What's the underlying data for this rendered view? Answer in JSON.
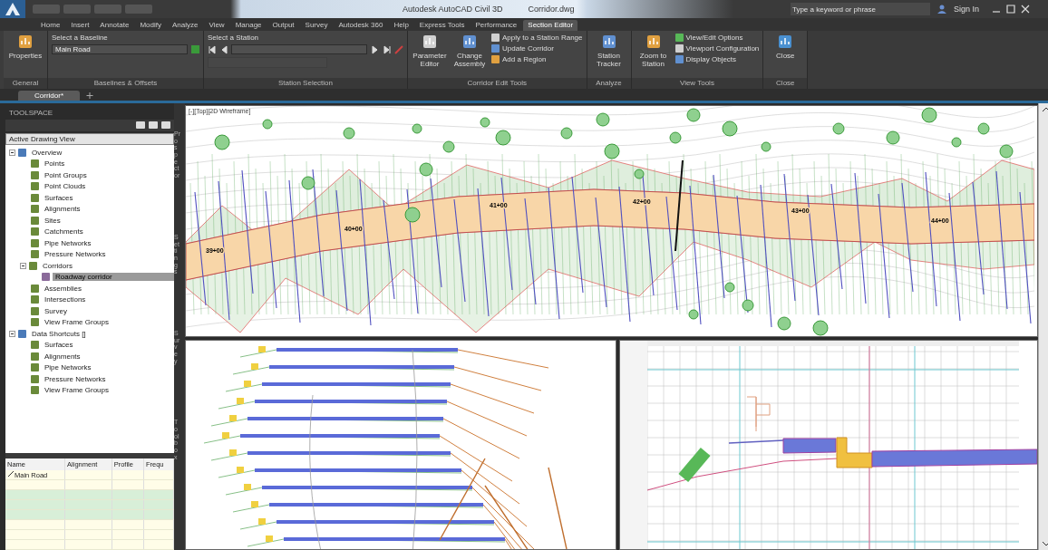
{
  "title_bar": {
    "title": "Autodesk AutoCAD Civil 3D",
    "file": "Corridor.dwg",
    "search_placeholder": "Type a keyword or phrase",
    "user": "Sign In"
  },
  "ribbon_tabs": [
    {
      "label": "Home",
      "selected": false
    },
    {
      "label": "Insert",
      "selected": false
    },
    {
      "label": "Annotate",
      "selected": false
    },
    {
      "label": "Modify",
      "selected": false
    },
    {
      "label": "Analyze",
      "selected": false
    },
    {
      "label": "View",
      "selected": false
    },
    {
      "label": "Manage",
      "selected": false
    },
    {
      "label": "Output",
      "selected": false
    },
    {
      "label": "Survey",
      "selected": false
    },
    {
      "label": "Autodesk 360",
      "selected": false
    },
    {
      "label": "Help",
      "selected": false
    },
    {
      "label": "Express Tools",
      "selected": false
    },
    {
      "label": "Performance",
      "selected": false
    },
    {
      "label": "Section Editor",
      "selected": true
    }
  ],
  "ribbon_panels": [
    {
      "title": "General",
      "items": [
        {
          "kind": "large",
          "label": "Properties"
        }
      ]
    },
    {
      "title": "Baselines & Offsets",
      "items": [
        {
          "kind": "caption",
          "label": "Select a Baseline"
        },
        {
          "kind": "combo",
          "label": "Main Road"
        }
      ]
    },
    {
      "title": "Station Selection",
      "items": [
        {
          "kind": "caption",
          "label": "Select a Station"
        },
        {
          "kind": "navcombo"
        },
        {
          "kind": "disabledfield"
        }
      ]
    },
    {
      "title": "Corridor Edit Tools",
      "items": [
        {
          "kind": "large",
          "label": "Parameter Editor"
        },
        {
          "kind": "large",
          "label": "Change Assembly"
        },
        {
          "kind": "small",
          "label": "Apply to a Station Range"
        },
        {
          "kind": "small",
          "label": "Update Corridor"
        },
        {
          "kind": "small",
          "label": "Add a Region"
        }
      ]
    },
    {
      "title": "Analyze",
      "items": [
        {
          "kind": "large",
          "label": "Station Tracker"
        }
      ]
    },
    {
      "title": "View Tools",
      "items": [
        {
          "kind": "large",
          "label": "Zoom to Station"
        },
        {
          "kind": "small",
          "label": "View/Edit Options"
        },
        {
          "kind": "small",
          "label": "Viewport Configuration"
        },
        {
          "kind": "small",
          "label": "Display Objects"
        }
      ]
    },
    {
      "title": "Close",
      "items": [
        {
          "kind": "large",
          "label": "Close"
        }
      ]
    }
  ],
  "document_tabs": [
    {
      "label": "Corridor*",
      "selected": true
    }
  ],
  "toolspace": {
    "title": "TOOLSPACE",
    "view": "Active Drawing View",
    "side_tabs": [
      "Prospector",
      "Settings",
      "Survey",
      "Toolbox"
    ],
    "tree": [
      {
        "label": "Overview",
        "expanded": true,
        "selected": false,
        "children": [
          {
            "label": "Points",
            "selected": false
          },
          {
            "label": "Point Groups",
            "selected": false
          },
          {
            "label": "Point Clouds",
            "selected": false
          },
          {
            "label": "Surfaces",
            "selected": false
          },
          {
            "label": "Alignments",
            "selected": false
          },
          {
            "label": "Sites",
            "selected": false
          },
          {
            "label": "Catchments",
            "selected": false
          },
          {
            "label": "Pipe Networks",
            "selected": false
          },
          {
            "label": "Pressure Networks",
            "selected": false
          },
          {
            "label": "Corridors",
            "expanded": true,
            "selected": false,
            "children": [
              {
                "label": "Roadway corridor",
                "selected": true
              }
            ]
          },
          {
            "label": "Assemblies",
            "selected": false
          },
          {
            "label": "Intersections",
            "selected": false
          },
          {
            "label": "Survey",
            "selected": false
          },
          {
            "label": "View Frame Groups",
            "selected": false
          }
        ]
      },
      {
        "label": "Data Shortcuts []",
        "expanded": true,
        "selected": false,
        "children": [
          {
            "label": "Surfaces",
            "selected": false
          },
          {
            "label": "Alignments",
            "selected": false
          },
          {
            "label": "Pipe Networks",
            "selected": false
          },
          {
            "label": "Pressure Networks",
            "selected": false
          },
          {
            "label": "View Frame Groups",
            "selected": false
          }
        ]
      }
    ]
  },
  "baseline_table": {
    "columns": [
      "Name",
      "Alignment",
      "Profile",
      "Frequ"
    ],
    "rows": [
      {
        "cells": [
          "Main Road",
          "",
          ""
        ]
      }
    ]
  },
  "plan_view": {
    "label": "[-][Top][2D Wireframe]",
    "stations": [
      "39+00",
      "40+00",
      "41+00",
      "42+00",
      "43+00",
      "44+00"
    ]
  }
}
